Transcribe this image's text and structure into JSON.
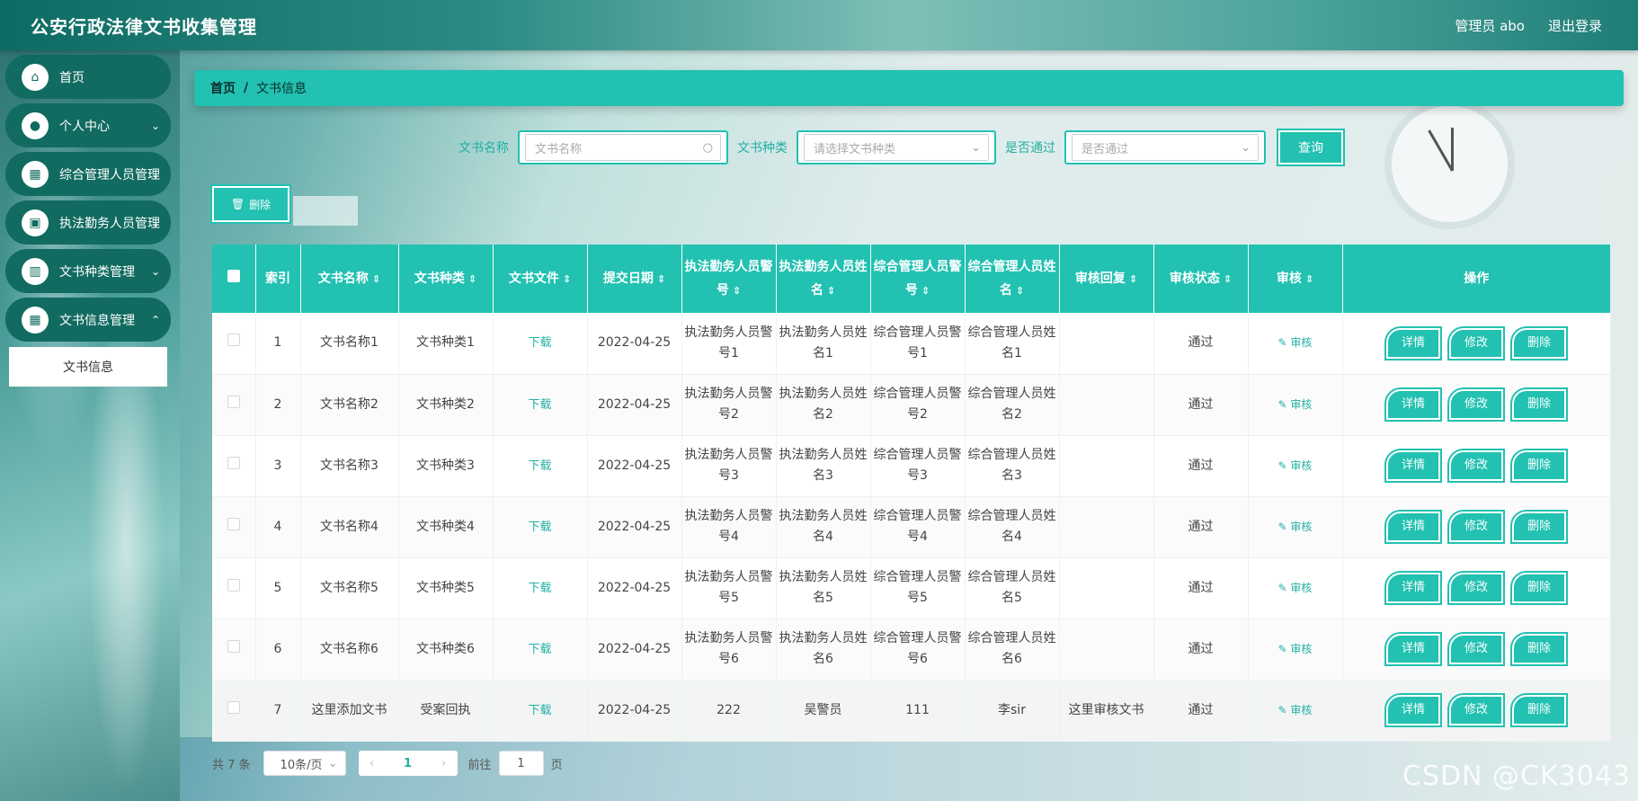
{
  "header": {
    "title": "公安行政法律文书收集管理",
    "user": "管理员 abo",
    "logout": "退出登录"
  },
  "sidebar": {
    "items": [
      {
        "label": "首页",
        "icon": "home-icon",
        "glyph": "⌂",
        "arrow": ""
      },
      {
        "label": "个人中心",
        "icon": "user-icon",
        "glyph": "●",
        "arrow": "⌄"
      },
      {
        "label": "综合管理人员管理",
        "icon": "grid-icon",
        "glyph": "▦",
        "arrow": "⌄"
      },
      {
        "label": "执法勤务人员管理",
        "icon": "wallet-icon",
        "glyph": "▣",
        "arrow": "⌄"
      },
      {
        "label": "文书种类管理",
        "icon": "bar-chart-icon",
        "glyph": "▥",
        "arrow": "⌄"
      },
      {
        "label": "文书信息管理",
        "icon": "grid-icon",
        "glyph": "▦",
        "arrow": "⌃"
      }
    ],
    "sub_item": "文书信息"
  },
  "breadcrumb": {
    "home": "首页",
    "sep": "/",
    "current": "文书信息"
  },
  "search": {
    "name_label": "文书名称",
    "name_placeholder": "文书名称",
    "type_label": "文书种类",
    "type_placeholder": "请选择文书种类",
    "pass_label": "是否通过",
    "pass_placeholder": "是否通过",
    "query_button": "查询"
  },
  "toolbar": {
    "delete_label": "删除",
    "delete_icon": "🗑"
  },
  "table": {
    "headers": [
      {
        "label": "索引",
        "sort": false
      },
      {
        "label": "文书名称",
        "sort": true
      },
      {
        "label": "文书种类",
        "sort": true
      },
      {
        "label": "文书文件",
        "sort": true
      },
      {
        "label": "提交日期",
        "sort": true
      },
      {
        "label": "执法勤务人员警号",
        "sort": true
      },
      {
        "label": "执法勤务人员姓名",
        "sort": true
      },
      {
        "label": "综合管理人员警号",
        "sort": true
      },
      {
        "label": "综合管理人员姓名",
        "sort": true
      },
      {
        "label": "审核回复",
        "sort": true
      },
      {
        "label": "审核状态",
        "sort": true
      },
      {
        "label": "审核",
        "sort": true
      },
      {
        "label": "操作",
        "sort": false
      }
    ],
    "rows": [
      {
        "index": "1",
        "name": "文书名称1",
        "type": "文书种类1",
        "file": "下载",
        "date": "2022-04-25",
        "officer_no": "执法勤务人员警号1",
        "officer_name": "执法勤务人员姓名1",
        "admin_no": "综合管理人员警号1",
        "admin_name": "综合管理人员姓名1",
        "reply": "",
        "status": "通过",
        "audit": "审核"
      },
      {
        "index": "2",
        "name": "文书名称2",
        "type": "文书种类2",
        "file": "下载",
        "date": "2022-04-25",
        "officer_no": "执法勤务人员警号2",
        "officer_name": "执法勤务人员姓名2",
        "admin_no": "综合管理人员警号2",
        "admin_name": "综合管理人员姓名2",
        "reply": "",
        "status": "通过",
        "audit": "审核"
      },
      {
        "index": "3",
        "name": "文书名称3",
        "type": "文书种类3",
        "file": "下载",
        "date": "2022-04-25",
        "officer_no": "执法勤务人员警号3",
        "officer_name": "执法勤务人员姓名3",
        "admin_no": "综合管理人员警号3",
        "admin_name": "综合管理人员姓名3",
        "reply": "",
        "status": "通过",
        "audit": "审核"
      },
      {
        "index": "4",
        "name": "文书名称4",
        "type": "文书种类4",
        "file": "下载",
        "date": "2022-04-25",
        "officer_no": "执法勤务人员警号4",
        "officer_name": "执法勤务人员姓名4",
        "admin_no": "综合管理人员警号4",
        "admin_name": "综合管理人员姓名4",
        "reply": "",
        "status": "通过",
        "audit": "审核"
      },
      {
        "index": "5",
        "name": "文书名称5",
        "type": "文书种类5",
        "file": "下载",
        "date": "2022-04-25",
        "officer_no": "执法勤务人员警号5",
        "officer_name": "执法勤务人员姓名5",
        "admin_no": "综合管理人员警号5",
        "admin_name": "综合管理人员姓名5",
        "reply": "",
        "status": "通过",
        "audit": "审核"
      },
      {
        "index": "6",
        "name": "文书名称6",
        "type": "文书种类6",
        "file": "下载",
        "date": "2022-04-25",
        "officer_no": "执法勤务人员警号6",
        "officer_name": "执法勤务人员姓名6",
        "admin_no": "综合管理人员警号6",
        "admin_name": "综合管理人员姓名6",
        "reply": "",
        "status": "通过",
        "audit": "审核"
      },
      {
        "index": "7",
        "name": "这里添加文书",
        "type": "受案回执",
        "file": "下载",
        "date": "2022-04-25",
        "officer_no": "222",
        "officer_name": "吴警员",
        "admin_no": "111",
        "admin_name": "李sir",
        "reply": "这里审核文书",
        "status": "通过",
        "audit": "审核"
      }
    ],
    "actions": {
      "detail": "详情",
      "edit": "修改",
      "delete": "删除"
    }
  },
  "pagination": {
    "total": "共 7 条",
    "page_size": "10条/页",
    "current_page": "1",
    "goto_label": "前往",
    "goto_value": "1",
    "goto_suffix": "页"
  },
  "watermark": "CSDN @CK3043",
  "colors": {
    "accent": "#22c1b1",
    "sidebar": "#116b60"
  }
}
